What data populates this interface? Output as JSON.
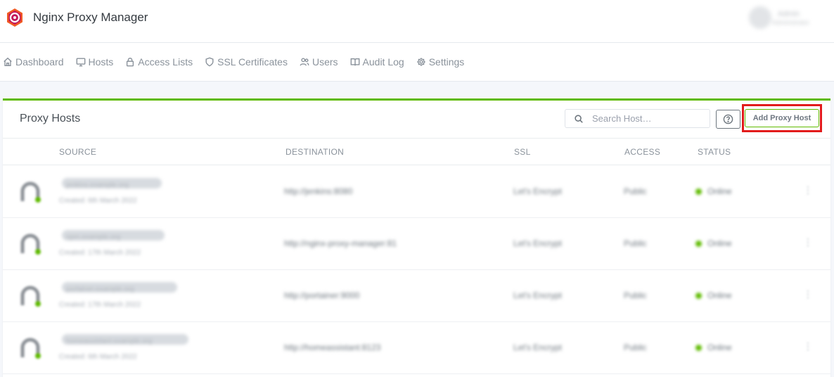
{
  "app": {
    "title": "Nginx Proxy Manager"
  },
  "user": {
    "name": "Admin",
    "role": "Administrator"
  },
  "nav": [
    {
      "label": "Dashboard",
      "icon": "home-icon"
    },
    {
      "label": "Hosts",
      "icon": "monitor-icon"
    },
    {
      "label": "Access Lists",
      "icon": "lock-icon"
    },
    {
      "label": "SSL Certificates",
      "icon": "shield-icon"
    },
    {
      "label": "Users",
      "icon": "users-icon"
    },
    {
      "label": "Audit Log",
      "icon": "book-icon"
    },
    {
      "label": "Settings",
      "icon": "gear-icon"
    }
  ],
  "card": {
    "title": "Proxy Hosts",
    "search_placeholder": "Search Host…",
    "add_button": "Add Proxy Host"
  },
  "table": {
    "columns": [
      "SOURCE",
      "DESTINATION",
      "SSL",
      "ACCESS",
      "STATUS"
    ],
    "rows": [
      {
        "source": "jenkins.example.org",
        "created": "Created: 6th March 2022",
        "destination": "http://jenkins:8080",
        "ssl": "Let's Encrypt",
        "access": "Public",
        "status": "Online"
      },
      {
        "source": "npm.example.org",
        "created": "Created: 17th March 2022",
        "destination": "http://nginx-proxy-manager:81",
        "ssl": "Let's Encrypt",
        "access": "Public",
        "status": "Online"
      },
      {
        "source": "portainer.example.org",
        "created": "Created: 17th March 2022",
        "destination": "http://portainer:9000",
        "ssl": "Let's Encrypt",
        "access": "Public",
        "status": "Online"
      },
      {
        "source": "homeassistant.example.org",
        "created": "Created: 6th March 2022",
        "destination": "http://homeassistant:8123",
        "ssl": "Let's Encrypt",
        "access": "Public",
        "status": "Online"
      }
    ]
  },
  "colors": {
    "accent": "#5eba00",
    "highlight": "#e21b1b"
  }
}
